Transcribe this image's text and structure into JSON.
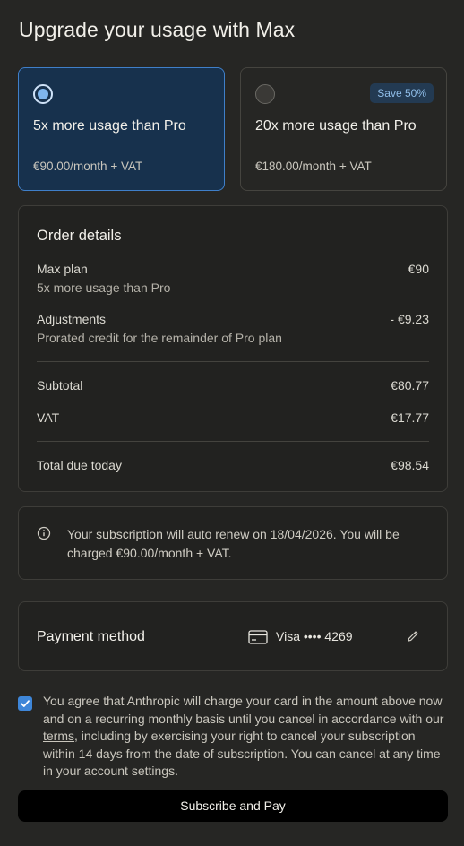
{
  "title": "Upgrade your usage with Max",
  "plans": [
    {
      "name": "5x more usage than Pro",
      "price": "€90.00/month + VAT",
      "selected": true
    },
    {
      "name": "20x more usage than Pro",
      "price": "€180.00/month + VAT",
      "selected": false,
      "badge": "Save 50%"
    }
  ],
  "order": {
    "title": "Order details",
    "max_plan_label": "Max plan",
    "max_plan_sub": "5x more usage than Pro",
    "max_plan_value": "€90",
    "adjustments_label": "Adjustments",
    "adjustments_sub": "Prorated credit for the remainder of Pro plan",
    "adjustments_value": "- €9.23",
    "subtotal_label": "Subtotal",
    "subtotal_value": "€80.77",
    "vat_label": "VAT",
    "vat_value": "€17.77",
    "total_label": "Total due today",
    "total_value": "€98.54"
  },
  "notice": {
    "icon": "info-icon",
    "text": "Your subscription will auto renew on 18/04/2026. You will be charged €90.00/month + VAT."
  },
  "payment": {
    "label": "Payment method",
    "card_icon": "credit-card-icon",
    "card_text": "Visa •••• 4269",
    "edit_icon": "pencil-icon"
  },
  "consent": {
    "checked": true,
    "before_link": "You agree that Anthropic will charge your card in the amount above now and on a recurring monthly basis until you cancel in accordance with our ",
    "link_text": "terms",
    "after_link": ", including by exercising your right to cancel your subscription within 14 days from the date of subscription. You can cancel at any time in your account settings."
  },
  "subscribe_label": "Subscribe and Pay",
  "colors": {
    "background": "#262624",
    "selected_plan_bg": "#17314d",
    "selected_plan_border": "#3f7fc9",
    "accent": "#3e86d8",
    "button_bg": "#000000"
  }
}
